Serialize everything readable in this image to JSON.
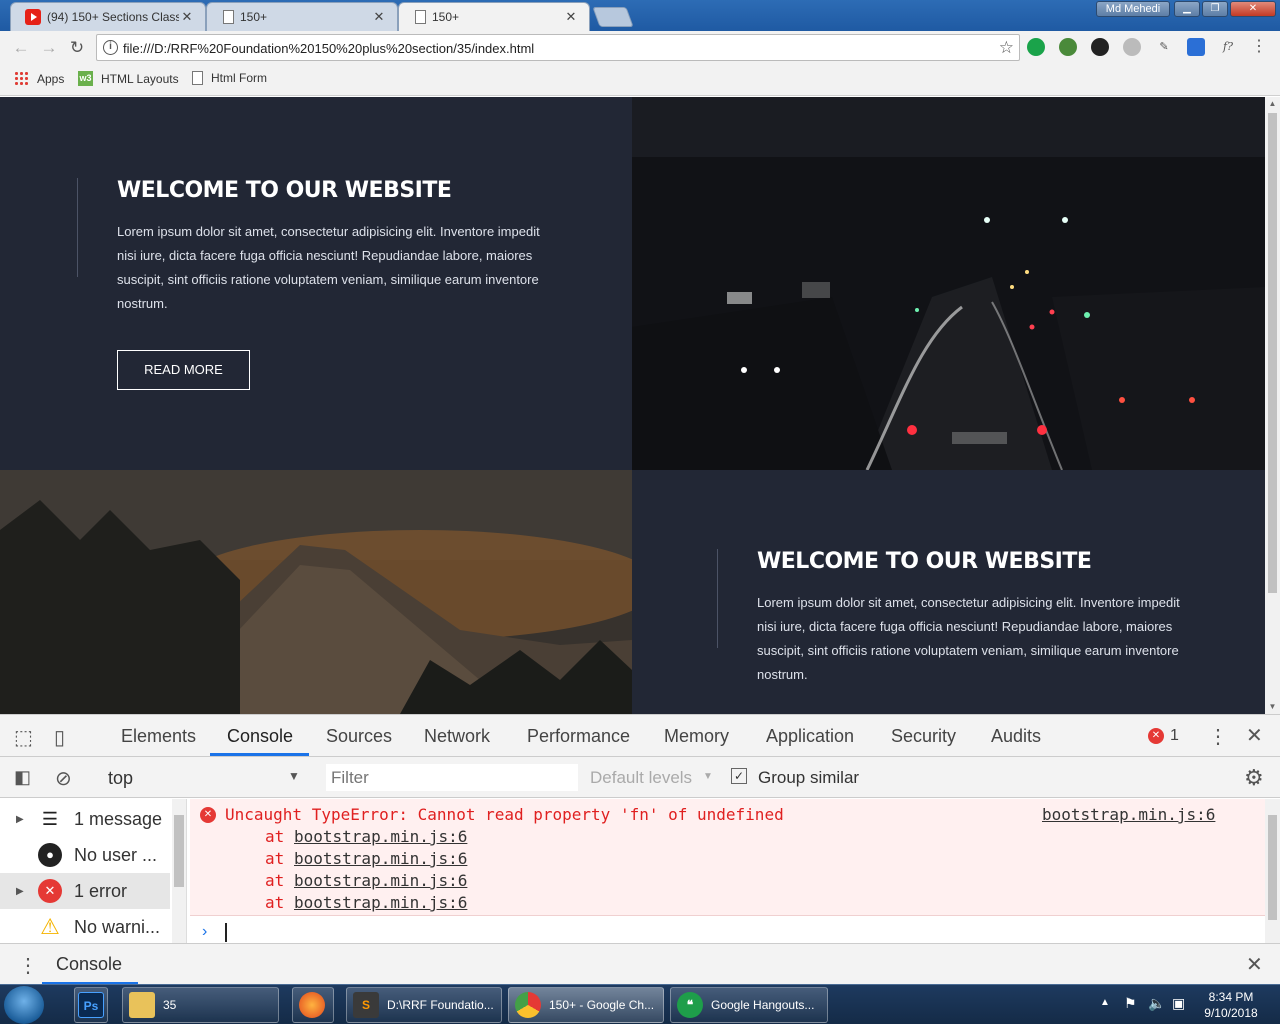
{
  "browser": {
    "tabs": [
      {
        "title": "(94) 150+ Sections Class",
        "favicon": "youtube-icon",
        "close": "✕"
      },
      {
        "title": "150+",
        "favicon": "page-icon",
        "close": "✕"
      },
      {
        "title": "150+",
        "favicon": "page-icon",
        "close": "✕",
        "active": true
      }
    ],
    "profile_name": "Md Mehedi",
    "url": "file:///D:/RRF%20Foundation%20150%20plus%20section/35/index.html",
    "bookmarks": [
      "Apps",
      "HTML Layouts",
      "Html Form"
    ]
  },
  "page": {
    "section1": {
      "heading": "WELCOME TO OUR WEBSITE",
      "body": "Lorem ipsum dolor sit amet, consectetur adipisicing elit. Inventore impedit nisi iure, dicta facere fuga officia nesciunt! Repudiandae labore, maiores suscipit, sint officiis ratione voluptatem veniam, similique earum inventore nostrum.",
      "button": "READ MORE"
    },
    "section2": {
      "heading": "WELCOME TO OUR WEBSITE",
      "body": "Lorem ipsum dolor sit amet, consectetur adipisicing elit. Inventore impedit nisi iure, dicta facere fuga officia nesciunt! Repudiandae labore, maiores suscipit, sint officiis ratione voluptatem veniam, similique earum inventore nostrum."
    },
    "colors": {
      "panel_bg": "#222735",
      "heading": "#ffffff",
      "text": "#dde1ea"
    }
  },
  "devtools": {
    "tabs": [
      "Elements",
      "Console",
      "Sources",
      "Network",
      "Performance",
      "Memory",
      "Application",
      "Security",
      "Audits"
    ],
    "active_tab": "Console",
    "error_count": "1",
    "context": "top",
    "filter_placeholder": "Filter",
    "levels": "Default levels",
    "group_similar": "Group similar",
    "sidebar": [
      {
        "label": "1 message",
        "icon": "list-icon"
      },
      {
        "label": "No user ...",
        "icon": "user-icon"
      },
      {
        "label": "1 error",
        "icon": "error-icon"
      },
      {
        "label": "No warni...",
        "icon": "warning-icon"
      }
    ],
    "error": {
      "message": "Uncaught TypeError: Cannot read property 'fn' of undefined",
      "source": "bootstrap.min.js:6",
      "stack_prefix": "at",
      "stack": [
        "bootstrap.min.js:6",
        "bootstrap.min.js:6",
        "bootstrap.min.js:6",
        "bootstrap.min.js:6"
      ]
    },
    "drawer_tab": "Console"
  },
  "taskbar": {
    "items": [
      {
        "label": "35",
        "icon": "folder-icon"
      },
      {
        "label": "D:\\RRF Foundatio...",
        "icon": "sublime-icon"
      },
      {
        "label": "150+ - Google Ch...",
        "icon": "chrome-icon"
      },
      {
        "label": "Google Hangouts...",
        "icon": "hangouts-icon"
      }
    ],
    "time": "8:34 PM",
    "date": "9/10/2018"
  }
}
